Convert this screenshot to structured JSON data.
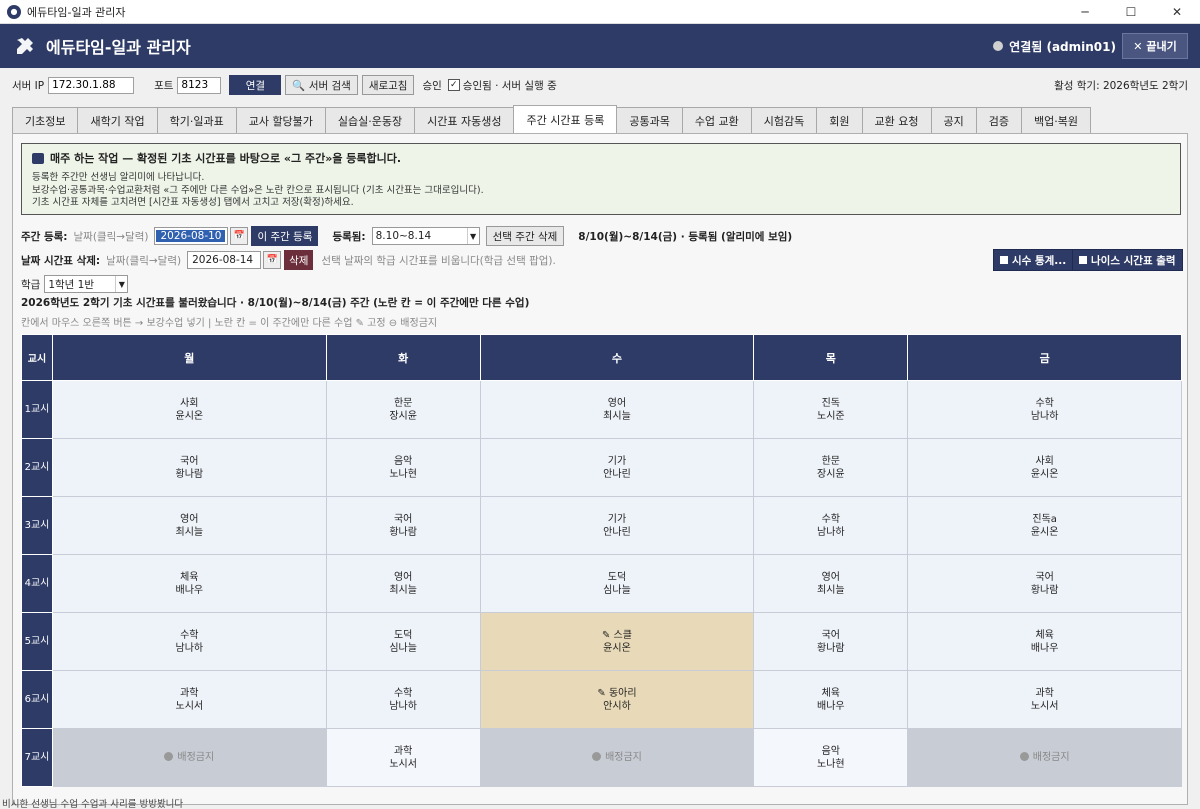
{
  "window": {
    "title": "에듀타임-일과 관리자",
    "minimize": "─",
    "maximize": "☐",
    "close": "✕"
  },
  "header": {
    "title": "에듀타임-일과 관리자",
    "status": "연결됨 (admin01)",
    "exit_label": "✕  끝내기"
  },
  "toolbar": {
    "server_ip_label": "서버 IP",
    "server_ip": "172.30.1.88",
    "port_label": "포트",
    "port": "8123",
    "connect": "연결",
    "search": "🔍 서버 검색",
    "refresh": "새로고침",
    "approve_label": "승인",
    "approved_text": "승인됨 · 서버 실행 중",
    "semester": "활성 학기: 2026학년도 2학기"
  },
  "tabs": [
    "기초정보",
    "새학기 작업",
    "학기·일과표",
    "교사 할당불가",
    "실습실·운동장",
    "시간표 자동생성",
    "주간 시간표 등록",
    "공통과목",
    "수업 교환",
    "시험감독",
    "회원",
    "교환 요청",
    "공지",
    "검증",
    "백업·복원"
  ],
  "active_tab": 6,
  "info": {
    "head": "매주 하는 작업 — 확정된 기초 시간표를 바탕으로 «그 주간»을 등록합니다.",
    "line1": "등록한 주간만 선생님 알리미에 나타납니다.",
    "line2": "보강수업·공통과목·수업교환처럼 «그 주에만 다른 수업»은 노란 칸으로 표시됩니다 (기초 시간표는 그대로입니다).",
    "line3": "기초 시간표 자체를 고치려면 [시간표 자동생성] 탭에서 고치고 저장(확정)하세요."
  },
  "week_reg": {
    "label": "주간 등록:",
    "hint": "날짜(클릭→달력)",
    "date": "2026-08-10",
    "cal": "📅",
    "register_btn": "이 주간 등록",
    "registered_label": "등록됨:",
    "registered_value": "8.10~8.14",
    "delete_btn": "선택 주간 삭제",
    "status": "8/10(월)~8/14(금) · 등록됨 (알리미에 보임)"
  },
  "date_delete": {
    "label": "날짜 시간표 삭제:",
    "hint": "날짜(클릭→달력)",
    "date": "2026-08-14",
    "cal": "📅",
    "delete_btn": "삭제",
    "desc": "선택 날짜의 학급 시간표를 비웁니다(학급 선택 팝업)."
  },
  "right_buttons": {
    "stats": "시수 통계...",
    "nice": "나이스 시간표 출력"
  },
  "class_select": {
    "label": "학급",
    "value": "1학년 1반"
  },
  "summary": "2026학년도 2학기 기초 시간표를 불러왔습니다  ·  8/10(월)~8/14(금) 주간  (노란 칸 = 이 주간에만 다른 수업)",
  "legend": "칸에서 마우스 오른쪽 버튼 → 보강수업 넣기    |  노란 칸 = 이 주간에만 다른 수업  ✎ 고정  ⊖ 배정금지",
  "timetable": {
    "period_header": "교시",
    "days": [
      "월",
      "화",
      "수",
      "목",
      "금"
    ],
    "periods": [
      "1교시",
      "2교시",
      "3교시",
      "4교시",
      "5교시",
      "6교시",
      "7교시"
    ],
    "cells": [
      [
        {
          "s": "사회",
          "t": "윤시온",
          "k": "n"
        },
        {
          "s": "한문",
          "t": "장시윤",
          "k": "n"
        },
        {
          "s": "영어",
          "t": "최시늘",
          "k": "n"
        },
        {
          "s": "진독",
          "t": "노시준",
          "k": "n"
        },
        {
          "s": "수학",
          "t": "남나하",
          "k": "n"
        }
      ],
      [
        {
          "s": "국어",
          "t": "황나람",
          "k": "n"
        },
        {
          "s": "음악",
          "t": "노나현",
          "k": "n"
        },
        {
          "s": "기가",
          "t": "안나린",
          "k": "n"
        },
        {
          "s": "한문",
          "t": "장시윤",
          "k": "n"
        },
        {
          "s": "사회",
          "t": "윤시온",
          "k": "n"
        }
      ],
      [
        {
          "s": "영어",
          "t": "최시늘",
          "k": "n"
        },
        {
          "s": "국어",
          "t": "황나람",
          "k": "n"
        },
        {
          "s": "기가",
          "t": "안나린",
          "k": "n"
        },
        {
          "s": "수학",
          "t": "남나하",
          "k": "n"
        },
        {
          "s": "진독a",
          "t": "윤시온",
          "k": "n"
        }
      ],
      [
        {
          "s": "체육",
          "t": "배나우",
          "k": "n"
        },
        {
          "s": "영어",
          "t": "최시늘",
          "k": "n"
        },
        {
          "s": "도덕",
          "t": "심나늘",
          "k": "n"
        },
        {
          "s": "영어",
          "t": "최시늘",
          "k": "n"
        },
        {
          "s": "국어",
          "t": "황나람",
          "k": "n"
        }
      ],
      [
        {
          "s": "수학",
          "t": "남나하",
          "k": "n"
        },
        {
          "s": "도덕",
          "t": "심나늘",
          "k": "n"
        },
        {
          "s": "✎ 스클",
          "t": "윤시온",
          "k": "c"
        },
        {
          "s": "국어",
          "t": "황나람",
          "k": "n"
        },
        {
          "s": "체육",
          "t": "배나우",
          "k": "n"
        }
      ],
      [
        {
          "s": "과학",
          "t": "노시서",
          "k": "n"
        },
        {
          "s": "수학",
          "t": "남나하",
          "k": "n"
        },
        {
          "s": "✎ 동아리",
          "t": "안시하",
          "k": "c"
        },
        {
          "s": "체육",
          "t": "배나우",
          "k": "n"
        },
        {
          "s": "과학",
          "t": "노시서",
          "k": "n"
        }
      ],
      [
        {
          "s": "배정금지",
          "t": "",
          "k": "b"
        },
        {
          "s": "과학",
          "t": "노시서",
          "k": "p"
        },
        {
          "s": "배정금지",
          "t": "",
          "k": "b"
        },
        {
          "s": "음악",
          "t": "노나현",
          "k": "p"
        },
        {
          "s": "배정금지",
          "t": "",
          "k": "b"
        }
      ]
    ]
  },
  "footer": "비시한 선생님 수업 수업과 사리를 방방봤니다"
}
